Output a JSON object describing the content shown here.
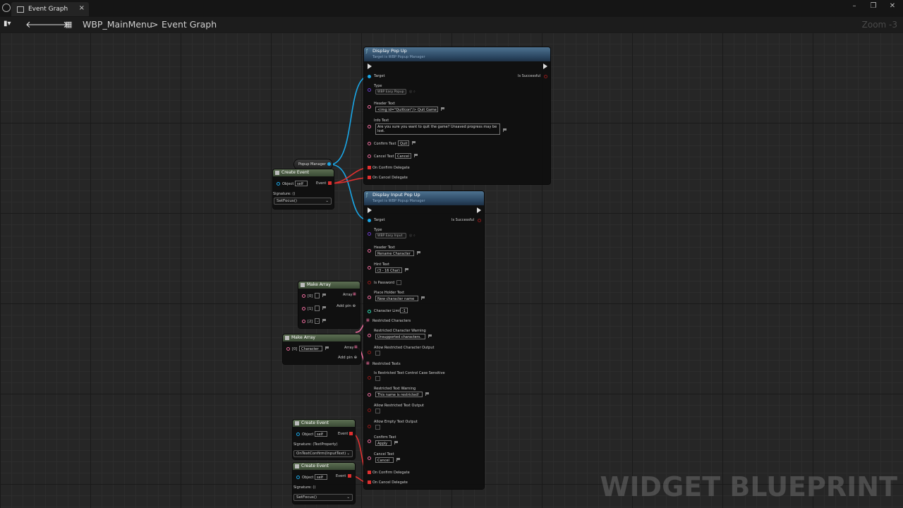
{
  "window": {
    "tab_title": "Event Graph",
    "tab_close": "×",
    "controls": {
      "minimize": "–",
      "restore": "❐",
      "close": "✕"
    }
  },
  "toolbar": {
    "back": "🡐",
    "forward": "🡒",
    "breadcrumb_root": "WBP_MainMenu",
    "breadcrumb_sep": ">",
    "breadcrumb_current": "Event Graph",
    "zoom": "Zoom -3"
  },
  "popup_manager": {
    "label": "Popup Manager"
  },
  "create_event_1": {
    "title": "Create Event",
    "object_label": "Object",
    "object_value": "self",
    "event_label": "Event",
    "signature": "Signature: ()",
    "function": "SetFocus()"
  },
  "display_popup": {
    "title": "Display Pop Up",
    "subtitle": "Target is WBP Popup Manager",
    "target": "Target",
    "is_successful": "Is Successful",
    "type": "Type",
    "type_value": "WBP Easy Popup",
    "header_text": "Header Text",
    "header_value": "<img id=\"QuitIcon\"/> Quit Game",
    "info_text": "Info Text",
    "info_value": "Are you sure you want to quit the game? Unsaved progress may be lost.",
    "confirm_text": "Confirm Text",
    "confirm_value": "Quit",
    "cancel_text": "Cancel Text",
    "cancel_value": "Cancel",
    "on_confirm": "On Confirm Delegate",
    "on_cancel": "On Cancel Delegate"
  },
  "display_input_popup": {
    "title": "Display Input Pop Up",
    "subtitle": "Target is WBP Popup Manager",
    "target": "Target",
    "is_successful": "Is Successful",
    "type": "Type",
    "type_value": "WBP Easy Input",
    "header_text": "Header Text",
    "header_value": "Rename Character",
    "hint_text": "Hint Text",
    "hint_value": "(3 - 16 Char)",
    "is_password": "Is Password",
    "placeholder_text": "Place Holder Text",
    "placeholder_value": "New character name",
    "character_limit": "Character Limit",
    "character_limit_value": "-1",
    "restricted_characters": "Restricted Characters",
    "restricted_char_warning": "Restricted Character Warning",
    "restricted_char_warning_value": "Unsupported characters.",
    "allow_restricted_char_output": "Allow Restricted Character Output",
    "restricted_texts": "Restricted Texts",
    "restricted_case": "Is Restricted Text Control Case Sensitive",
    "restricted_text_warning": "Restricted Text Warning",
    "restricted_text_warning_value": "This name is restricted!",
    "allow_restricted_text_output": "Allow Restricted Text Output",
    "allow_empty_text_output": "Allow Empty Text Output",
    "confirm_text": "Confirm Text",
    "confirm_value": "Apply",
    "cancel_text": "Cancel Text",
    "cancel_value": "Cancel",
    "on_confirm": "On Confirm Delegate",
    "on_cancel": "On Cancel Delegate"
  },
  "make_array_1": {
    "title": "Make Array",
    "array": "Array",
    "pins": [
      "[0]",
      "[1]",
      "[2]"
    ],
    "values": [
      "",
      "",
      "-"
    ],
    "add_pin": "Add pin"
  },
  "make_array_2": {
    "title": "Make Array",
    "array": "Array",
    "pin": "[0]",
    "value": "Character",
    "add_pin": "Add pin"
  },
  "create_event_2": {
    "title": "Create Event",
    "object_label": "Object",
    "object_value": "self",
    "event_label": "Event",
    "signature": "Signature: (TextProperty)",
    "function": "OnTextConfirm(InputText)"
  },
  "create_event_3": {
    "title": "Create Event",
    "object_label": "Object",
    "object_value": "self",
    "event_label": "Event",
    "signature": "Signature: ()",
    "function": "SetFocus()"
  },
  "watermark": "WIDGET BLUEPRINT",
  "colors": {
    "object_wire": "#1aa6e6",
    "delegate_wire": "#e03030",
    "header_blue": "#2a4560",
    "header_green": "#3a4a34"
  }
}
